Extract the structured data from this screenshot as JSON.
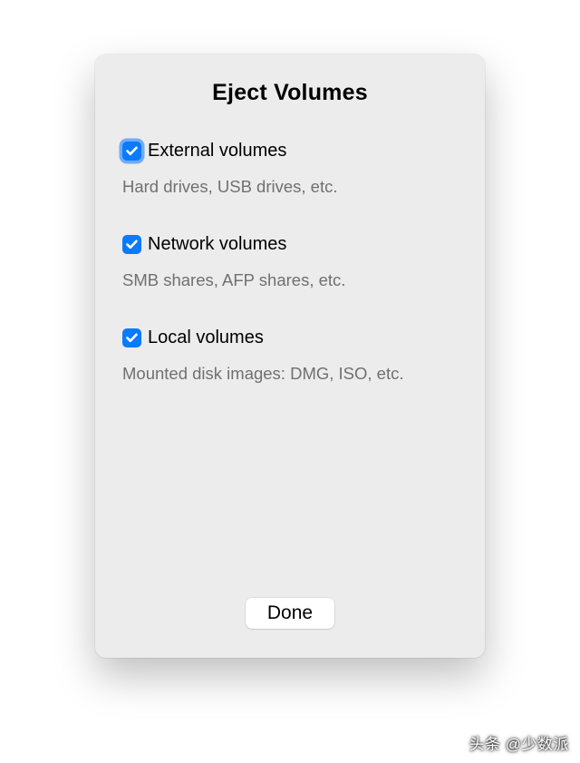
{
  "dialog": {
    "title": "Eject Volumes",
    "options": [
      {
        "id": "external",
        "label": "External volumes",
        "description": "Hard drives, USB drives, etc.",
        "checked": true,
        "focused": true
      },
      {
        "id": "network",
        "label": "Network volumes",
        "description": "SMB shares, AFP shares, etc.",
        "checked": true,
        "focused": false
      },
      {
        "id": "local",
        "label": "Local volumes",
        "description": "Mounted disk images: DMG, ISO, etc.",
        "checked": true,
        "focused": false
      }
    ],
    "done_label": "Done"
  },
  "watermark": "头条 @少数派"
}
